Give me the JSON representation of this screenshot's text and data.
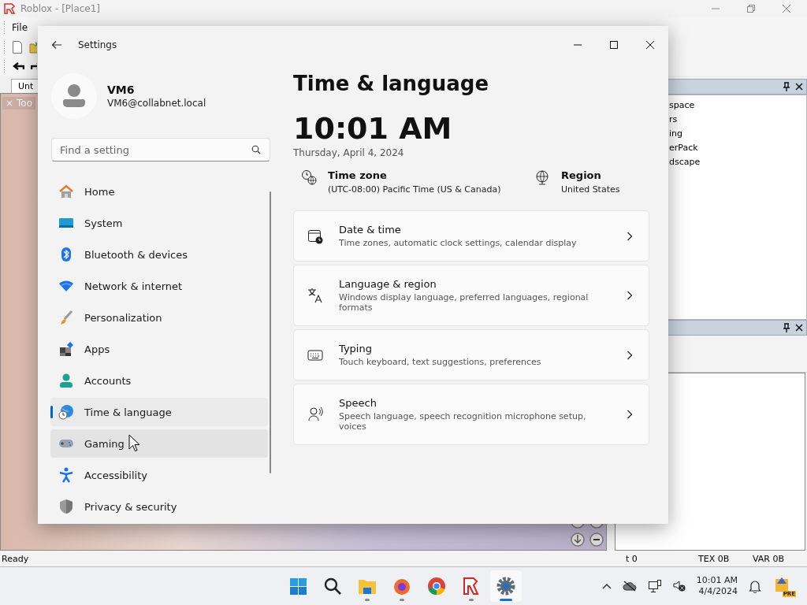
{
  "studio": {
    "title": "Roblox - [Place1]",
    "menu": [
      "File"
    ],
    "doc_tab": "Unt",
    "toolbox_tab": {
      "close": "×",
      "label": "Too"
    },
    "explorer_items": [
      "space",
      "rs",
      "ing",
      "erPack",
      "dscape"
    ],
    "status": [
      "Ready",
      "t 0",
      "TEX 0B",
      "VAR 0B"
    ]
  },
  "settings": {
    "title": "Settings",
    "user": {
      "name": "VM6",
      "email": "VM6@collabnet.local"
    },
    "search": {
      "placeholder": "Find a setting"
    },
    "nav": [
      {
        "label": "Home",
        "selected": false,
        "hovered": false
      },
      {
        "label": "System",
        "selected": false,
        "hovered": false
      },
      {
        "label": "Bluetooth & devices",
        "selected": false,
        "hovered": false
      },
      {
        "label": "Network & internet",
        "selected": false,
        "hovered": false
      },
      {
        "label": "Personalization",
        "selected": false,
        "hovered": false
      },
      {
        "label": "Apps",
        "selected": false,
        "hovered": false
      },
      {
        "label": "Accounts",
        "selected": false,
        "hovered": false
      },
      {
        "label": "Time & language",
        "selected": true,
        "hovered": false
      },
      {
        "label": "Gaming",
        "selected": false,
        "hovered": true
      },
      {
        "label": "Accessibility",
        "selected": false,
        "hovered": false
      },
      {
        "label": "Privacy & security",
        "selected": false,
        "hovered": false
      }
    ],
    "page_title": "Time & language",
    "clock": "10:01 AM",
    "date": "Thursday, April 4, 2024",
    "info": [
      {
        "label": "Time zone",
        "value": "(UTC-08:00) Pacific Time (US & Canada)"
      },
      {
        "label": "Region",
        "value": "United States"
      }
    ],
    "cards": [
      {
        "title": "Date & time",
        "description": "Time zones, automatic clock settings, calendar display"
      },
      {
        "title": "Language & region",
        "description": "Windows display language, preferred languages, regional formats"
      },
      {
        "title": "Typing",
        "description": "Touch keyboard, text suggestions, preferences"
      },
      {
        "title": "Speech",
        "description": "Speech language, speech recognition microphone setup, voices"
      }
    ]
  },
  "taskbar": {
    "apps": [
      {
        "running": false,
        "active": false
      },
      {
        "running": false,
        "active": false
      },
      {
        "running": true,
        "active": false
      },
      {
        "running": true,
        "active": false
      },
      {
        "running": false,
        "active": false
      },
      {
        "running": true,
        "active": false
      },
      {
        "running": true,
        "active": true
      }
    ],
    "time": "10:01 AM",
    "date": "4/4/2024",
    "badge": "PRE"
  }
}
